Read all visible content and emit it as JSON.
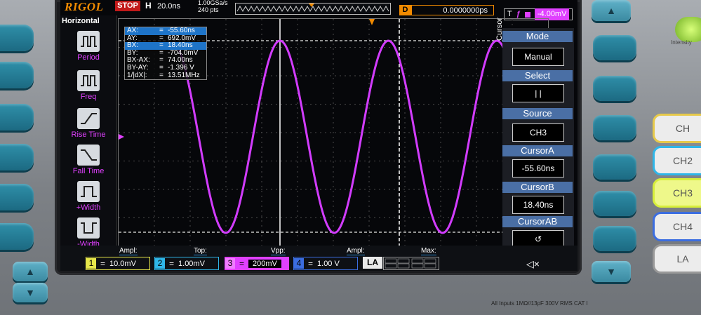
{
  "brand": "RIGOL",
  "status": "STOP",
  "horizontal": {
    "label": "H",
    "timebase": "20.0ns",
    "sample_rate": "1.00GSa/s",
    "points": "240 pts"
  },
  "delay": {
    "label": "D",
    "value": "0.0000000ps"
  },
  "trigger": {
    "label": "T",
    "edge_icon": "rising-edge-icon",
    "channel": "CH3",
    "level": "-4.00mV"
  },
  "left_menu": {
    "title": "Horizontal",
    "items": [
      {
        "label": "Period",
        "icon": "period-icon"
      },
      {
        "label": "Freq",
        "icon": "freq-icon"
      },
      {
        "label": "Rise Time",
        "icon": "rise-time-icon"
      },
      {
        "label": "Fall Time",
        "icon": "fall-time-icon"
      },
      {
        "label": "+Width",
        "icon": "plus-width-icon"
      },
      {
        "label": "-Width",
        "icon": "minus-width-icon"
      }
    ]
  },
  "cursor_readout": [
    {
      "key": "AX:",
      "eq": "=",
      "value": "-55.60ns"
    },
    {
      "key": "AY:",
      "eq": "=",
      "value": "692.0mV"
    },
    {
      "key": "BX:",
      "eq": "=",
      "value": "18.40ns"
    },
    {
      "key": "BY:",
      "eq": "=",
      "value": "-704.0mV"
    },
    {
      "key": "BX-AX:",
      "eq": "=",
      "value": "74.00ns"
    },
    {
      "key": "BY-AY:",
      "eq": "=",
      "value": "-1.396 V"
    },
    {
      "key": "1/|dX|:",
      "eq": "=",
      "value": "13.51MHz"
    }
  ],
  "right_menu": {
    "side_label": "Cursor",
    "items": [
      {
        "title": "Mode",
        "value": "Manual"
      },
      {
        "title": "Select",
        "value": "| |"
      },
      {
        "title": "Source",
        "value": "CH3"
      },
      {
        "title": "CursorA",
        "value": "-55.60ns"
      },
      {
        "title": "CursorB",
        "value": "18.40ns"
      },
      {
        "title": "CursorAB",
        "value": "↺"
      }
    ]
  },
  "measure_labels": [
    "Ampl:",
    "Top:",
    "Vpp:",
    "Ampl:",
    "Max:"
  ],
  "channels": [
    {
      "num": "1",
      "eq": "=",
      "scale": "10.0mV",
      "color": "#e6e64a"
    },
    {
      "num": "2",
      "eq": "=",
      "scale": "1.00mV",
      "color": "#2fb6e8"
    },
    {
      "num": "3",
      "eq": "=",
      "scale": "200mV",
      "color": "#e040ff"
    },
    {
      "num": "4",
      "eq": "=",
      "scale": "1.00 V",
      "color": "#3b6de0"
    }
  ],
  "la_label": "LA",
  "front_panel": {
    "intensity": "Intensity",
    "channel_keys": [
      "CH",
      "CH2",
      "CH3",
      "CH4",
      "LA"
    ],
    "input_spec": "All Inputs 1MΩ//13pF 300V RMS  CAT I"
  },
  "waveform_color": "#d23cff"
}
